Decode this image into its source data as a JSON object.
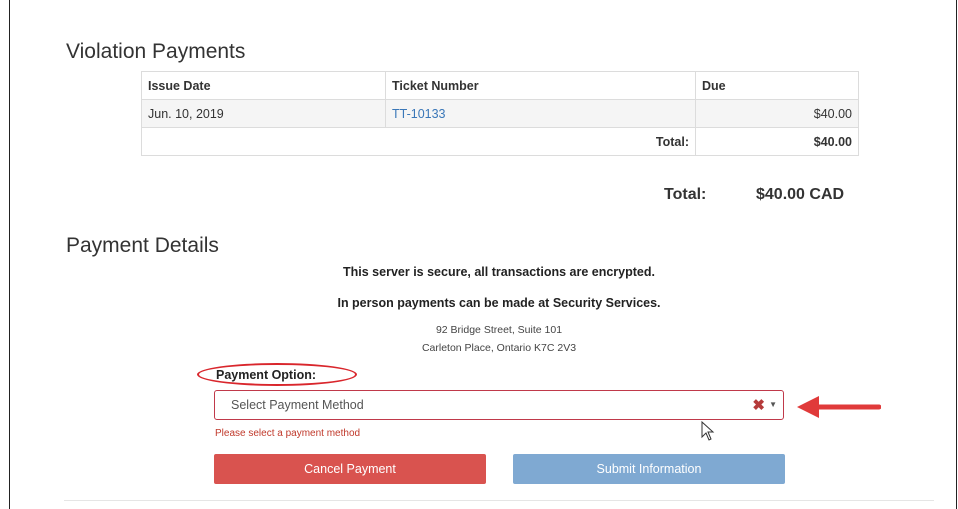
{
  "violation_payments": {
    "title": "Violation Payments",
    "columns": [
      "Issue Date",
      "Ticket Number",
      "Due"
    ],
    "rows": [
      {
        "issue_date": "Jun. 10, 2019",
        "ticket_number": "TT-10133",
        "due": "$40.00"
      }
    ],
    "subtotal_label": "Total:",
    "subtotal_value": "$40.00"
  },
  "grand_total": {
    "label": "Total:",
    "value": "$40.00 CAD"
  },
  "payment_details": {
    "title": "Payment Details",
    "secure_notice": "This server is secure, all transactions are encrypted.",
    "in_person_notice": "In person payments can be made at Security Services.",
    "address_line1": "92 Bridge Street, Suite 101",
    "address_line2": "Carleton Place, Ontario K7C 2V3",
    "payment_option_label": "Payment Option:",
    "select_placeholder": "Select Payment Method",
    "error_message": "Please select a payment method"
  },
  "buttons": {
    "cancel": "Cancel Payment",
    "submit": "Submit Information"
  },
  "colors": {
    "annotation_red": "#d9262c",
    "cancel_button": "#d9534f",
    "submit_button": "#7fa9d2",
    "link": "#3a77b8",
    "error": "#c0392b"
  },
  "icons": {
    "clear": "clear-x-icon",
    "dropdown": "caret-down-icon",
    "annotation_arrow": "arrow-left-icon",
    "mouse_cursor": "mouse-pointer-icon"
  }
}
